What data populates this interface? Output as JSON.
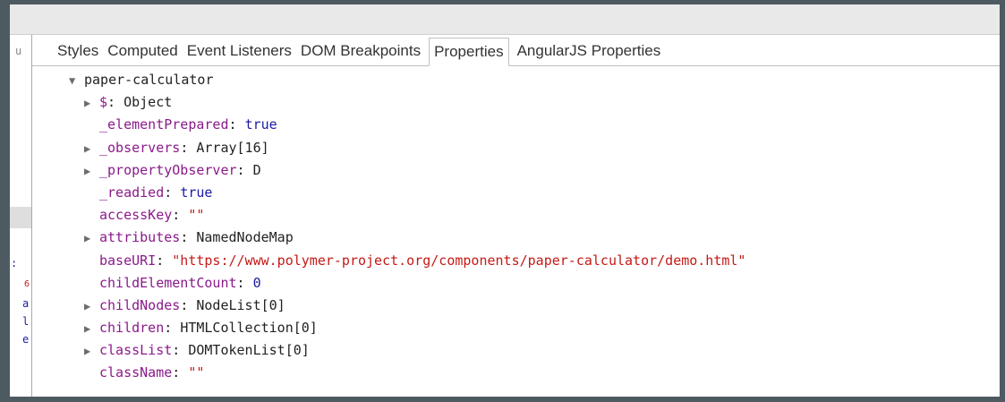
{
  "tabs": [
    {
      "label": "Styles",
      "active": false
    },
    {
      "label": "Computed",
      "active": false
    },
    {
      "label": "Event Listeners",
      "active": false
    },
    {
      "label": "DOM Breakpoints",
      "active": false
    },
    {
      "label": "Properties",
      "active": true
    },
    {
      "label": "AngularJS Properties",
      "active": false
    }
  ],
  "tree": {
    "root": "paper-calculator",
    "rows": [
      {
        "expandable": true,
        "key": "$",
        "value": "Object",
        "type": "obj"
      },
      {
        "expandable": false,
        "key": "_elementPrepared",
        "value": "true",
        "type": "bool"
      },
      {
        "expandable": true,
        "key": "_observers",
        "value": "Array[16]",
        "type": "obj"
      },
      {
        "expandable": true,
        "key": "_propertyObserver",
        "value": "D",
        "type": "obj"
      },
      {
        "expandable": false,
        "key": "_readied",
        "value": "true",
        "type": "bool"
      },
      {
        "expandable": false,
        "key": "accessKey",
        "value": "\"\"",
        "type": "str"
      },
      {
        "expandable": true,
        "key": "attributes",
        "value": "NamedNodeMap",
        "type": "obj"
      },
      {
        "expandable": false,
        "key": "baseURI",
        "value": "\"https://www.polymer-project.org/components/paper-calculator/demo.html\"",
        "type": "str"
      },
      {
        "expandable": false,
        "key": "childElementCount",
        "value": "0",
        "type": "num"
      },
      {
        "expandable": true,
        "key": "childNodes",
        "value": "NodeList[0]",
        "type": "obj"
      },
      {
        "expandable": true,
        "key": "children",
        "value": "HTMLCollection[0]",
        "type": "obj"
      },
      {
        "expandable": true,
        "key": "classList",
        "value": "DOMTokenList[0]",
        "type": "obj"
      },
      {
        "expandable": false,
        "key": "className",
        "value": "\"\"",
        "type": "str"
      }
    ]
  },
  "left_fragments": [
    {
      "text": "u",
      "color": "#888888"
    },
    {
      "text": ":",
      "color": "#1a1aa6"
    },
    {
      "text": "6",
      "color": "#c41a16"
    },
    {
      "text": "a",
      "color": "#1a1aa6"
    },
    {
      "text": "l",
      "color": "#1a1aa6"
    },
    {
      "text": "e",
      "color": "#1a1aa6"
    }
  ]
}
